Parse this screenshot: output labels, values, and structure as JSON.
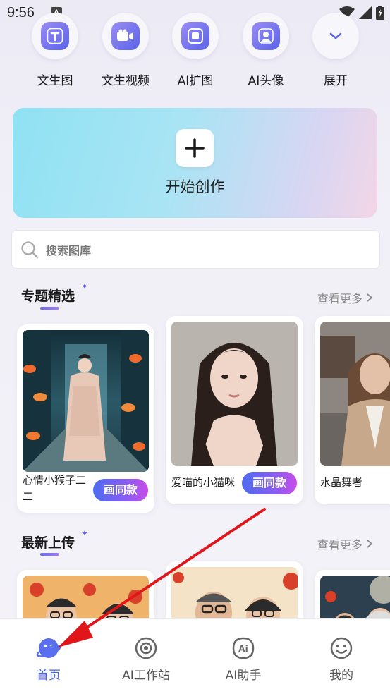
{
  "status": {
    "time": "9:56",
    "notif_glyph": "A"
  },
  "shortcuts": [
    {
      "label": "文生图",
      "icon": "text-to-image-icon"
    },
    {
      "label": "文生视频",
      "icon": "text-to-video-icon"
    },
    {
      "label": "AI扩图",
      "icon": "ai-expand-icon"
    },
    {
      "label": "AI头像",
      "icon": "ai-avatar-icon"
    },
    {
      "label": "展开",
      "icon": "chevron-down-icon"
    }
  ],
  "create": {
    "label": "开始创作"
  },
  "search": {
    "placeholder": "搜索图库"
  },
  "featured": {
    "title": "专题精选",
    "more": "查看更多",
    "cards": [
      {
        "title": "心情小猴子二二",
        "button": "画同款"
      },
      {
        "title": "爱喵的小猫咪",
        "button": "画同款"
      },
      {
        "title": "水晶舞者"
      }
    ]
  },
  "latest": {
    "title": "最新上传",
    "more": "查看更多"
  },
  "nav": {
    "items": [
      {
        "label": "首页",
        "active": true
      },
      {
        "label": "AI工作站"
      },
      {
        "label": "AI助手"
      },
      {
        "label": "我的"
      }
    ]
  },
  "colors": {
    "accent": "#4a62ee",
    "annotation_arrow": "#e0161b"
  }
}
